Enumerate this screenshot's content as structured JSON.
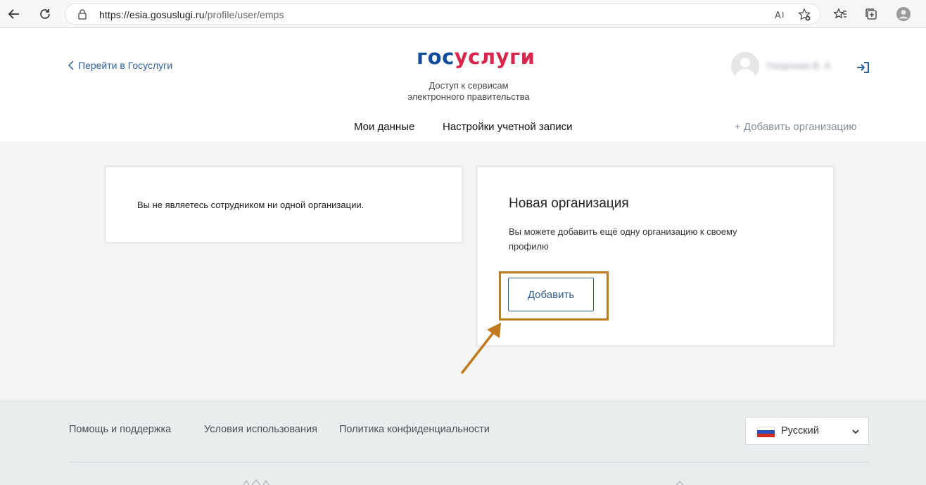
{
  "browser": {
    "url_host": "https://esia.gosuslugi.ru",
    "url_path": "/profile/user/emps",
    "read_aloud_icon": "A⁾"
  },
  "header": {
    "back_link": "Перейти в Госуслуги",
    "logo_part1": "гос",
    "logo_part2": "услуги",
    "tagline_line1": "Доступ к сервисам",
    "tagline_line2": "электронного правительства",
    "username": "Голдтенко В. А.",
    "nav_my_data": "Мои данные",
    "nav_account_settings": "Настройки учетной записи",
    "add_organization": "+ Добавить организацию"
  },
  "main": {
    "not_employee_message": "Вы не являетесь сотрудником ни одной организации.",
    "new_org_title": "Новая организация",
    "new_org_description": "Вы можете добавить ещё одну организацию к своему профилю",
    "add_button": "Добавить"
  },
  "footer": {
    "help": "Помощь и поддержка",
    "terms": "Условия использования",
    "privacy": "Политика конфиденциальности",
    "language": "Русский"
  },
  "colors": {
    "highlight": "#c07a1e",
    "brand_blue": "#0f4c9c",
    "brand_red": "#d8254b"
  }
}
